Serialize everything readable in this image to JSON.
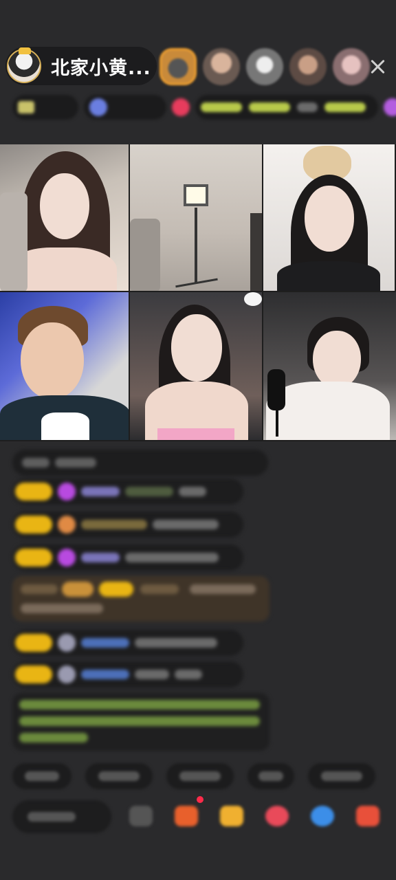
{
  "header": {
    "host_name": "北家小黄...",
    "close_icon": "close-icon"
  },
  "colors": {
    "background": "#2a2a2c",
    "level_badge": "#e9b514",
    "pill": "#1c1c1e"
  }
}
